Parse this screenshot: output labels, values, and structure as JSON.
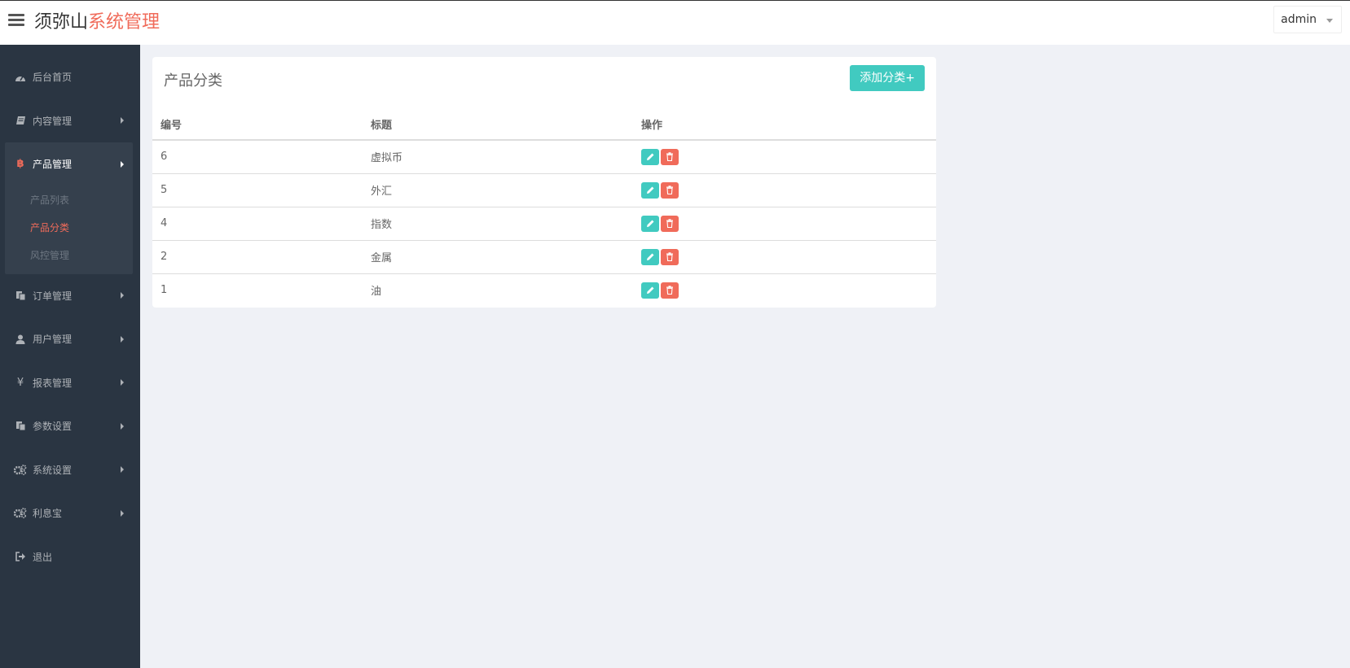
{
  "brand": {
    "part1": "须弥山",
    "part2": "系统管理",
    "accent_color": "#f06b5a"
  },
  "header": {
    "menu_icon": "bars-icon",
    "user": "admin"
  },
  "sidebar": {
    "items": [
      {
        "label": "后台首页",
        "icon": "dashboard-icon"
      },
      {
        "label": "内容管理",
        "icon": "book-icon"
      },
      {
        "label": "产品管理",
        "icon": "bitcoin-icon",
        "expanded": true,
        "children": [
          {
            "label": "产品列表"
          },
          {
            "label": "产品分类",
            "active": true
          },
          {
            "label": "风控管理"
          }
        ]
      },
      {
        "label": "订单管理",
        "icon": "copy-icon"
      },
      {
        "label": "用户管理",
        "icon": "user-icon"
      },
      {
        "label": "报表管理",
        "icon": "yen-icon"
      },
      {
        "label": "参数设置",
        "icon": "copy-icon"
      },
      {
        "label": "系统设置",
        "icon": "cogs-icon"
      },
      {
        "label": "利息宝",
        "icon": "cogs-icon"
      },
      {
        "label": "退出",
        "icon": "sign-out-icon"
      }
    ]
  },
  "main": {
    "title": "产品分类",
    "add_button": "添加分类+",
    "table": {
      "headers": [
        "编号",
        "标题",
        "操作"
      ],
      "rows": [
        {
          "id": "6",
          "title": "虚拟币"
        },
        {
          "id": "5",
          "title": "外汇"
        },
        {
          "id": "4",
          "title": "指数"
        },
        {
          "id": "2",
          "title": "金属"
        },
        {
          "id": "1",
          "title": "油"
        }
      ]
    }
  },
  "colors": {
    "sidebar_bg": "#2a3542",
    "teal": "#41cac0",
    "red": "#f06b5a",
    "page_bg": "#eff1f6"
  }
}
